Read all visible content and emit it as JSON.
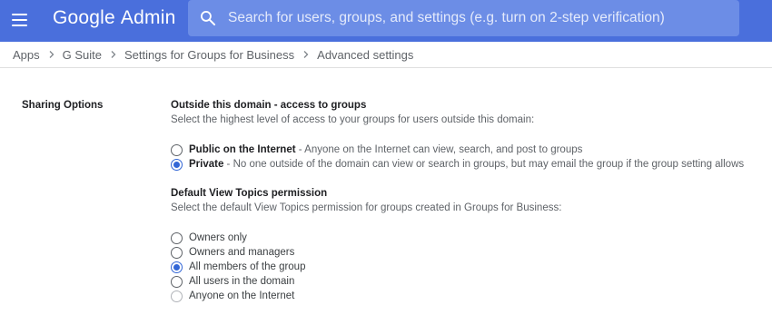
{
  "header": {
    "logo_brand": "Google",
    "logo_product": "Admin",
    "search_placeholder": "Search for users, groups, and settings (e.g. turn on 2-step verification)",
    "menu_icon": "hamburger-menu-icon",
    "search_icon": "search-icon"
  },
  "breadcrumb": {
    "items": [
      "Apps",
      "G Suite",
      "Settings for Groups for Business",
      "Advanced settings"
    ]
  },
  "section": {
    "label": "Sharing Options"
  },
  "access_group": {
    "title": "Outside this domain - access to groups",
    "description": "Select the highest level of access to your groups for users outside this domain:",
    "options": [
      {
        "label": "Public on the Internet",
        "detail": " - Anyone on the Internet can view, search, and post to groups",
        "checked": false
      },
      {
        "label": "Private",
        "detail": " - No one outside of the domain can view or search in groups, but may email the group if the group setting allows",
        "checked": true
      }
    ]
  },
  "view_topics": {
    "title": "Default View Topics permission",
    "description": "Select the default View Topics permission for groups created in Groups for Business:",
    "options": [
      {
        "label": "Owners only",
        "checked": false
      },
      {
        "label": "Owners and managers",
        "checked": false
      },
      {
        "label": "All members of the group",
        "checked": true
      },
      {
        "label": "All users in the domain",
        "checked": false
      },
      {
        "label": "Anyone on the Internet",
        "checked": false
      }
    ]
  },
  "colors": {
    "header_bg": "#4a6fdc",
    "search_bg": "#6c8de6",
    "radio_selected": "#3367d6"
  }
}
